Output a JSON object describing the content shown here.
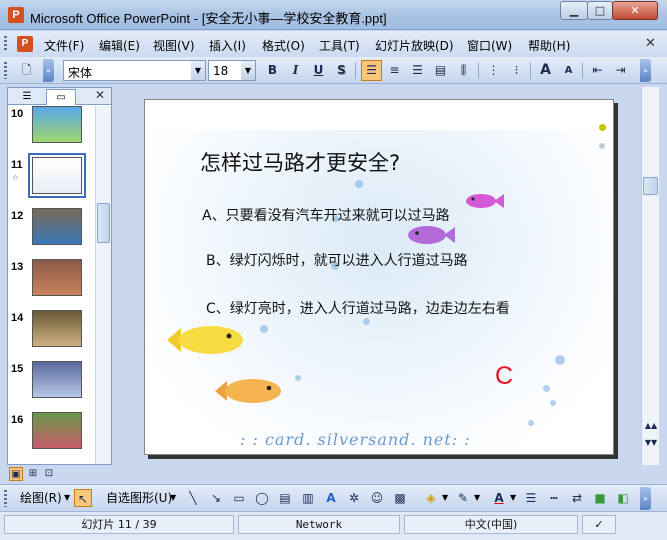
{
  "window": {
    "title": "Microsoft Office PowerPoint - [安全无小事—学校安全教育.ppt]",
    "min_glyph": "▁",
    "max_glyph": "□",
    "close_glyph": "✕"
  },
  "menu": [
    "文件(F)",
    "编辑(E)",
    "视图(V)",
    "插入(I)",
    "格式(O)",
    "工具(T)",
    "幻灯片放映(D)",
    "窗口(W)",
    "帮助(H)"
  ],
  "format_toolbar": {
    "font_name": "宋体",
    "font_size": "18",
    "bold": "B",
    "italic": "I",
    "underline": "U",
    "shadow": "S",
    "grow_font": "A",
    "shrink_font": "A"
  },
  "slide_thumbnails": [
    {
      "number": "10",
      "colors": [
        "#58a8e8",
        "#9fd66a"
      ]
    },
    {
      "number": "11",
      "colors": [
        "#ffffff",
        "#e8eef5"
      ],
      "selected": true
    },
    {
      "number": "12",
      "colors": [
        "#7a6a5a",
        "#3b79b8"
      ]
    },
    {
      "number": "13",
      "colors": [
        "#8a5a4a",
        "#c9845a"
      ]
    },
    {
      "number": "14",
      "colors": [
        "#6a5a3a",
        "#d0b080"
      ]
    },
    {
      "number": "15",
      "colors": [
        "#5a6aa0",
        "#b8c8e8"
      ]
    },
    {
      "number": "16",
      "colors": [
        "#6a9a4a",
        "#c85a6a"
      ]
    }
  ],
  "panel": {
    "close_glyph": "✕"
  },
  "slide": {
    "title": "怎样过马路才更安全?",
    "options": [
      "A、只要看没有汽车开过来就可以过马路",
      "B、绿灯闪烁时，就可以进入人行道过马路",
      "C、绿灯亮时，进入人行道过马路，边走边左右看"
    ],
    "answer": "C",
    "watermark": ": : card. silversand. net: :"
  },
  "drawing_toolbar": {
    "draw_label": "绘图(R)",
    "autoshapes_label": "自选图形(U)"
  },
  "status": {
    "slide_position": "幻灯片 11 / 39",
    "design": "Network",
    "language": "中文(中国)"
  },
  "icons": {
    "app": "powerpoint-icon",
    "accent_orange": "#f8c77c",
    "answer_color": "#e8121b"
  }
}
